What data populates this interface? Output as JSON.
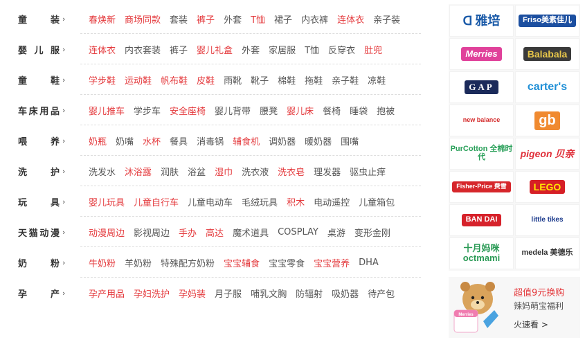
{
  "categories": [
    {
      "title": "童装",
      "items": [
        {
          "label": "春焕新",
          "hot": true
        },
        {
          "label": "商场同款",
          "hot": true
        },
        {
          "label": "套装",
          "hot": false
        },
        {
          "label": "裤子",
          "hot": true
        },
        {
          "label": "外套",
          "hot": false
        },
        {
          "label": "T恤",
          "hot": true
        },
        {
          "label": "裙子",
          "hot": false
        },
        {
          "label": "内衣裤",
          "hot": false
        },
        {
          "label": "连体衣",
          "hot": true
        },
        {
          "label": "亲子装",
          "hot": false
        }
      ]
    },
    {
      "title": "婴儿服",
      "items": [
        {
          "label": "连体衣",
          "hot": true
        },
        {
          "label": "内衣套装",
          "hot": false
        },
        {
          "label": "裤子",
          "hot": false
        },
        {
          "label": "婴儿礼盒",
          "hot": true
        },
        {
          "label": "外套",
          "hot": false
        },
        {
          "label": "家居服",
          "hot": false
        },
        {
          "label": "T恤",
          "hot": false
        },
        {
          "label": "反穿衣",
          "hot": false
        },
        {
          "label": "肚兜",
          "hot": true
        }
      ]
    },
    {
      "title": "童鞋",
      "items": [
        {
          "label": "学步鞋",
          "hot": true
        },
        {
          "label": "运动鞋",
          "hot": true
        },
        {
          "label": "帆布鞋",
          "hot": true
        },
        {
          "label": "皮鞋",
          "hot": true
        },
        {
          "label": "雨靴",
          "hot": false
        },
        {
          "label": "靴子",
          "hot": false
        },
        {
          "label": "棉鞋",
          "hot": false
        },
        {
          "label": "拖鞋",
          "hot": false
        },
        {
          "label": "亲子鞋",
          "hot": false
        },
        {
          "label": "凉鞋",
          "hot": false
        }
      ]
    },
    {
      "title": "车床用品",
      "items": [
        {
          "label": "婴儿推车",
          "hot": true
        },
        {
          "label": "学步车",
          "hot": false
        },
        {
          "label": "安全座椅",
          "hot": true
        },
        {
          "label": "婴儿背带",
          "hot": false
        },
        {
          "label": "腰凳",
          "hot": false
        },
        {
          "label": "婴儿床",
          "hot": true
        },
        {
          "label": "餐椅",
          "hot": false
        },
        {
          "label": "睡袋",
          "hot": false
        },
        {
          "label": "抱被",
          "hot": false
        }
      ]
    },
    {
      "title": "喂养",
      "items": [
        {
          "label": "奶瓶",
          "hot": true
        },
        {
          "label": "奶嘴",
          "hot": false
        },
        {
          "label": "水杯",
          "hot": true
        },
        {
          "label": "餐具",
          "hot": false
        },
        {
          "label": "消毒锅",
          "hot": false
        },
        {
          "label": "辅食机",
          "hot": true
        },
        {
          "label": "调奶器",
          "hot": false
        },
        {
          "label": "暖奶器",
          "hot": false
        },
        {
          "label": "围嘴",
          "hot": false
        }
      ]
    },
    {
      "title": "洗护",
      "items": [
        {
          "label": "洗发水",
          "hot": false
        },
        {
          "label": "沐浴露",
          "hot": true
        },
        {
          "label": "润肤",
          "hot": false
        },
        {
          "label": "浴盆",
          "hot": false
        },
        {
          "label": "湿巾",
          "hot": true
        },
        {
          "label": "洗衣液",
          "hot": false
        },
        {
          "label": "洗衣皂",
          "hot": true
        },
        {
          "label": "理发器",
          "hot": false
        },
        {
          "label": "驱虫止痒",
          "hot": false
        }
      ]
    },
    {
      "title": "玩具",
      "items": [
        {
          "label": "婴儿玩具",
          "hot": true
        },
        {
          "label": "儿童自行车",
          "hot": true
        },
        {
          "label": "儿童电动车",
          "hot": false
        },
        {
          "label": "毛绒玩具",
          "hot": false
        },
        {
          "label": "积木",
          "hot": true
        },
        {
          "label": "电动遥控",
          "hot": false
        },
        {
          "label": "儿童箱包",
          "hot": false
        }
      ]
    },
    {
      "title": "天猫动漫",
      "items": [
        {
          "label": "动漫周边",
          "hot": true
        },
        {
          "label": "影视周边",
          "hot": false
        },
        {
          "label": "手办",
          "hot": true
        },
        {
          "label": "高达",
          "hot": true
        },
        {
          "label": "魔术道具",
          "hot": false
        },
        {
          "label": "COSPLAY",
          "hot": false
        },
        {
          "label": "桌游",
          "hot": false
        },
        {
          "label": "变形金刚",
          "hot": false
        }
      ]
    },
    {
      "title": "奶粉",
      "items": [
        {
          "label": "牛奶粉",
          "hot": true
        },
        {
          "label": "羊奶粉",
          "hot": false
        },
        {
          "label": "特殊配方奶粉",
          "hot": false
        },
        {
          "label": "宝宝辅食",
          "hot": true
        },
        {
          "label": "宝宝零食",
          "hot": false
        },
        {
          "label": "宝宝营养",
          "hot": true
        },
        {
          "label": "DHA",
          "hot": false
        }
      ]
    },
    {
      "title": "孕产",
      "items": [
        {
          "label": "孕产用品",
          "hot": true
        },
        {
          "label": "孕妇洗护",
          "hot": true
        },
        {
          "label": "孕妈装",
          "hot": true
        },
        {
          "label": "月子服",
          "hot": false
        },
        {
          "label": "哺乳文胸",
          "hot": false
        },
        {
          "label": "防辐射",
          "hot": false
        },
        {
          "label": "吸奶器",
          "hot": false
        },
        {
          "label": "待产包",
          "hot": false
        }
      ]
    }
  ],
  "arrow_glyph": "›",
  "brands": [
    {
      "label": "雅培",
      "prefix": "ᗡ",
      "icon": "abbott-logo",
      "color": "#1a5aa8",
      "bg": "#ffffff"
    },
    {
      "label": "Friso美素佳儿",
      "icon": "friso-logo",
      "color": "#ffffff",
      "bg": "#1c4fa0"
    },
    {
      "label": "Merries",
      "icon": "merries-logo",
      "color": "#ffffff",
      "bg": "#e0419a"
    },
    {
      "label": "Balabala",
      "icon": "balabala-logo",
      "color": "#e7c64a",
      "bg": "#3a3a3a"
    },
    {
      "label": "GAP",
      "icon": "gap-logo",
      "color": "#ffffff",
      "bg": "#1b2a5a"
    },
    {
      "label": "carter's",
      "icon": "carters-logo",
      "color": "#1f8fd6",
      "bg": "#ffffff"
    },
    {
      "label": "new balance",
      "icon": "new-balance-logo",
      "color": "#d42b2b",
      "bg": "#ffffff"
    },
    {
      "label": "gb",
      "icon": "gb-logo",
      "color": "#ffffff",
      "bg": "#f08a30"
    },
    {
      "label": "PurCotton 全棉时代",
      "icon": "purcotton-logo",
      "color": "#2aa05a",
      "bg": "#ffffff"
    },
    {
      "label": "pigeon 贝亲",
      "icon": "pigeon-logo",
      "color": "#e0303a",
      "bg": "#ffffff"
    },
    {
      "label": "Fisher-Price 费雪",
      "icon": "fisher-price-logo",
      "color": "#ffffff",
      "bg": "#d6262b"
    },
    {
      "label": "LEGO",
      "icon": "lego-logo",
      "color": "#ffe600",
      "bg": "#d61f26"
    },
    {
      "label": "BAN DAI",
      "icon": "bandai-logo",
      "color": "#ffffff",
      "bg": "#d6222b"
    },
    {
      "label": "little tikes",
      "icon": "little-tikes-logo",
      "color": "#1b3a8c",
      "bg": "#ffffff"
    },
    {
      "label": "十月妈咪 octmami",
      "icon": "octmami-logo",
      "color": "#2a9a55",
      "bg": "#ffffff"
    },
    {
      "label": "medela 美德乐",
      "icon": "medela-logo",
      "color": "#333333",
      "bg": "#ffffff"
    }
  ],
  "promo": {
    "title": "超值9元换购",
    "subtitle": "辣妈萌宝福利",
    "link": "火速看 >",
    "image_icon": "bear-diapers-image",
    "image_label": "Merries"
  },
  "colors": {
    "hot": "#e4393c",
    "normal": "#555555",
    "title": "#333333",
    "divider": "#dddddd",
    "panel_bg": "#f7f7f7"
  }
}
